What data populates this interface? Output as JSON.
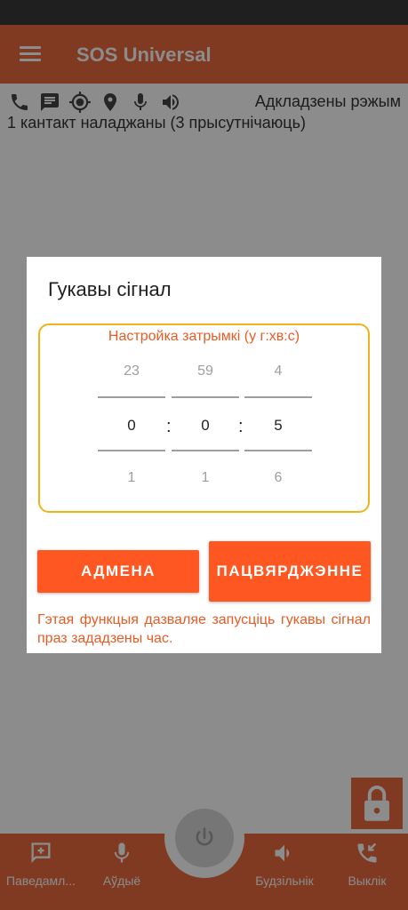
{
  "app": {
    "title": "SOS Universal",
    "mode": "Адкладзены рэжым",
    "contacts": "1 кантакт наладжаны (3 прысутнічаюць)",
    "status_icons": [
      "phone-icon",
      "message-icon",
      "gps-icon",
      "location-pin-icon",
      "microphone-icon",
      "speaker-icon"
    ]
  },
  "bottom_nav": [
    {
      "label": "Паведамл...",
      "icon": "add-message-icon"
    },
    {
      "label": "Аўдыё",
      "icon": "microphone-icon"
    },
    {
      "label": "Будзільнік",
      "icon": "speaker-icon"
    },
    {
      "label": "Выклік",
      "icon": "incoming-call-icon"
    }
  ],
  "dialog": {
    "title": "Гукавы сігнал",
    "picker_caption": "Настройка затрымкі (у г:хв:с)",
    "hours": {
      "prev": "23",
      "current": "0",
      "next": "1"
    },
    "minutes": {
      "prev": "59",
      "current": "0",
      "next": "1"
    },
    "seconds": {
      "prev": "4",
      "current": "5",
      "next": "6"
    },
    "separator": ":",
    "cancel_label": "АДМЕНА",
    "confirm_label": "ПАЦВЯРДЖЭННЕ",
    "note": "Гэтая функцыя дазваляе запусціць гукавы сігнал праз зададзены час."
  },
  "colors": {
    "primary": "#ea6a3e",
    "accent": "#ff5722",
    "picker_border": "#f2b21a",
    "caption": "#ea5a24"
  }
}
